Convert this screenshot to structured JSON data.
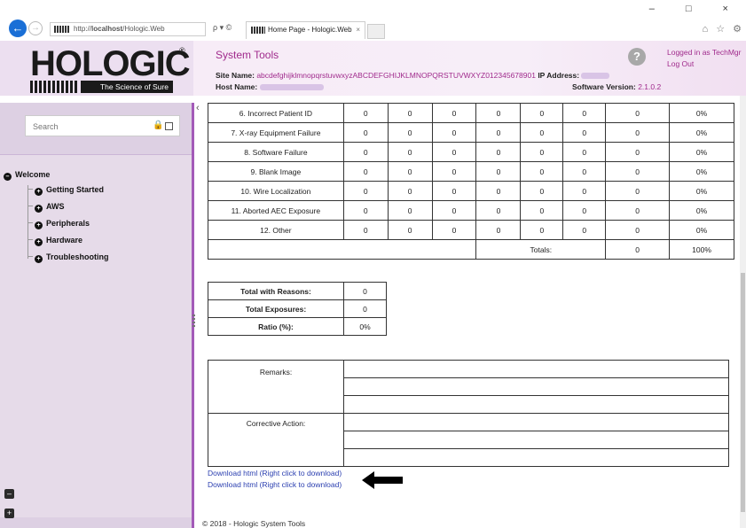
{
  "browser": {
    "url_prefix": "http://",
    "url_host": "localhost",
    "url_path": "/Hologic.Web",
    "search_ctrl": "ρ ▾ ©",
    "tab_title": "Home Page - Hologic.Web",
    "tab_close": "×",
    "win_ctrls": "– □ ×",
    "tool_icons": "⌂ ☆ ⚙"
  },
  "header": {
    "logo": "HOLOGIC",
    "logo_reg": "®",
    "tagline": "The Science of Sure",
    "title": "System Tools",
    "site_name_label": "Site Name:",
    "site_name": "abcdefghijklmnopqrstuvwxyzABCDEFGHIJKLMNOPQRSTUVWXYZ012345678901",
    "ip_label": "IP Address:",
    "host_label": "Host Name:",
    "software_label": "Software Version:",
    "software_version": "2.1.0.2",
    "logged_in": "Logged in as TechMgr",
    "logout": "Log Out",
    "help": "?"
  },
  "sidebar": {
    "search_placeholder": "Search",
    "nav": {
      "welcome": "Welcome",
      "items": [
        "Getting Started",
        "AWS",
        "Peripherals",
        "Hardware",
        "Troubleshooting"
      ]
    }
  },
  "reasons": {
    "rows": [
      [
        "6. Incorrect Patient ID",
        "0",
        "0",
        "0",
        "0",
        "0",
        "0",
        "0",
        "0%"
      ],
      [
        "7. X-ray Equipment Failure",
        "0",
        "0",
        "0",
        "0",
        "0",
        "0",
        "0",
        "0%"
      ],
      [
        "8. Software Failure",
        "0",
        "0",
        "0",
        "0",
        "0",
        "0",
        "0",
        "0%"
      ],
      [
        "9. Blank Image",
        "0",
        "0",
        "0",
        "0",
        "0",
        "0",
        "0",
        "0%"
      ],
      [
        "10. Wire Localization",
        "0",
        "0",
        "0",
        "0",
        "0",
        "0",
        "0",
        "0%"
      ],
      [
        "11. Aborted AEC Exposure",
        "0",
        "0",
        "0",
        "0",
        "0",
        "0",
        "0",
        "0%"
      ],
      [
        "12. Other",
        "0",
        "0",
        "0",
        "0",
        "0",
        "0",
        "0",
        "0%"
      ]
    ],
    "totals_label": "Totals:",
    "totals_value": "0",
    "totals_pct": "100%"
  },
  "summary": {
    "with_reasons_label": "Total with Reasons:",
    "with_reasons": "0",
    "exposures_label": "Total Exposures:",
    "exposures": "0",
    "ratio_label": "Ratio (%):",
    "ratio": "0%"
  },
  "notes": {
    "remarks_label": "Remarks:",
    "corrective_label": "Corrective Action:"
  },
  "downloads": {
    "link1": "Download html (Right click to download)",
    "link2": "Download html (Right click to download)"
  },
  "footer": "© 2018 - Hologic System Tools"
}
